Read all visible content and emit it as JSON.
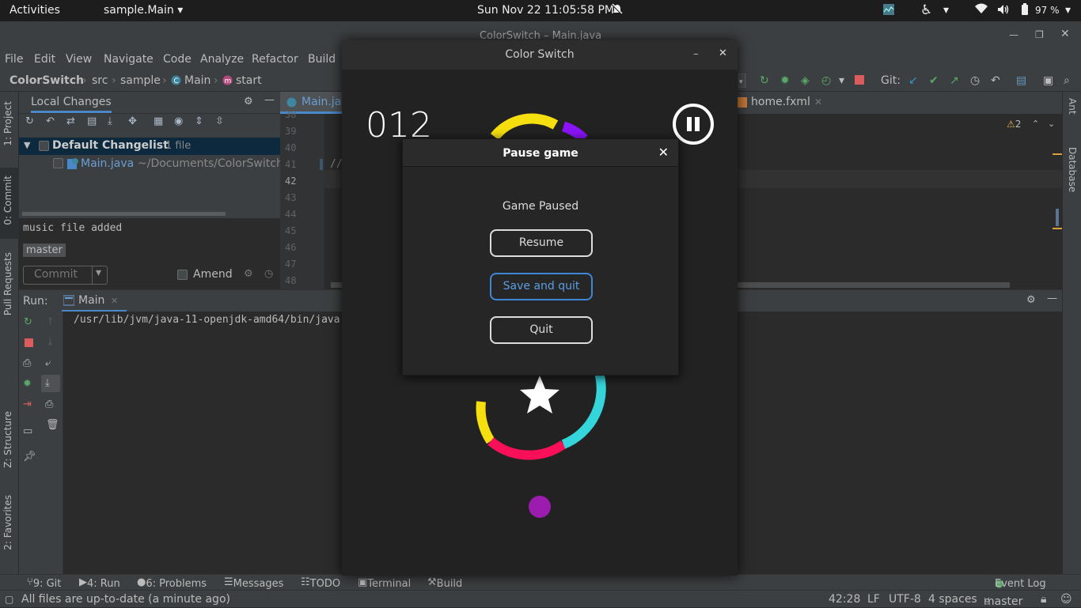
{
  "topbar": {
    "activities": "Activities",
    "app_menu": "sample.Main",
    "clock": "Sun Nov 22  11:05:58 PM",
    "battery": "97 %"
  },
  "ide": {
    "window_title": "ColorSwitch – Main.java",
    "menu": [
      "File",
      "Edit",
      "View",
      "Navigate",
      "Code",
      "Analyze",
      "Refactor",
      "Build"
    ],
    "breadcrumb": [
      "ColorSwitch",
      "src",
      "sample",
      "Main",
      "start"
    ],
    "git_label": "Git:",
    "left_tabs": [
      "1: Project",
      "0: Commit",
      "Pull Requests",
      "Z: Structure",
      "2: Favorites"
    ],
    "right_tabs": [
      "Ant",
      "Database"
    ],
    "commit_panel": {
      "title": "Local Changes",
      "changelist": "Default Changelist",
      "changelist_count": "1 file",
      "file_name": "Main.java",
      "file_path": "~/Documents/ColorSwitch",
      "message": "music file added",
      "branch": "master",
      "commit_label": "Commit",
      "amend_label": "Amend"
    },
    "editor": {
      "tab_main": "Main.java",
      "tab_home": "home.fxml",
      "warning_count": "2",
      "line_numbers": [
        "38",
        "39",
        "40",
        "41",
        "42",
        "43",
        "44",
        "45",
        "46",
        "47",
        "48"
      ],
      "code_snippet": "//"
    },
    "run": {
      "label": "Run:",
      "tab": "Main",
      "output": "/usr/lib/jvm/java-11-openjdk-amd64/bin/java"
    },
    "bottom_tools": [
      "9: Git",
      "4: Run",
      "6: Problems",
      "Messages",
      "TODO",
      "Terminal",
      "Build"
    ],
    "event_log": "Event Log",
    "status": {
      "message": "All files are up-to-date (a minute ago)",
      "position": "42:28",
      "line_sep": "LF",
      "encoding": "UTF-8",
      "indent": "4 spaces",
      "branch": "master"
    }
  },
  "game": {
    "window_title": "Color Switch",
    "score": "012",
    "colors": {
      "yellow": "#f6df0e",
      "purple": "#8c13fb",
      "cyan": "#35e2f2",
      "pink": "#ff0080",
      "ball": "#9c1cb0"
    },
    "dialog": {
      "title": "Pause game",
      "paused_text": "Game Paused",
      "resume": "Resume",
      "save_quit": "Save and quit",
      "quit": "Quit"
    }
  }
}
